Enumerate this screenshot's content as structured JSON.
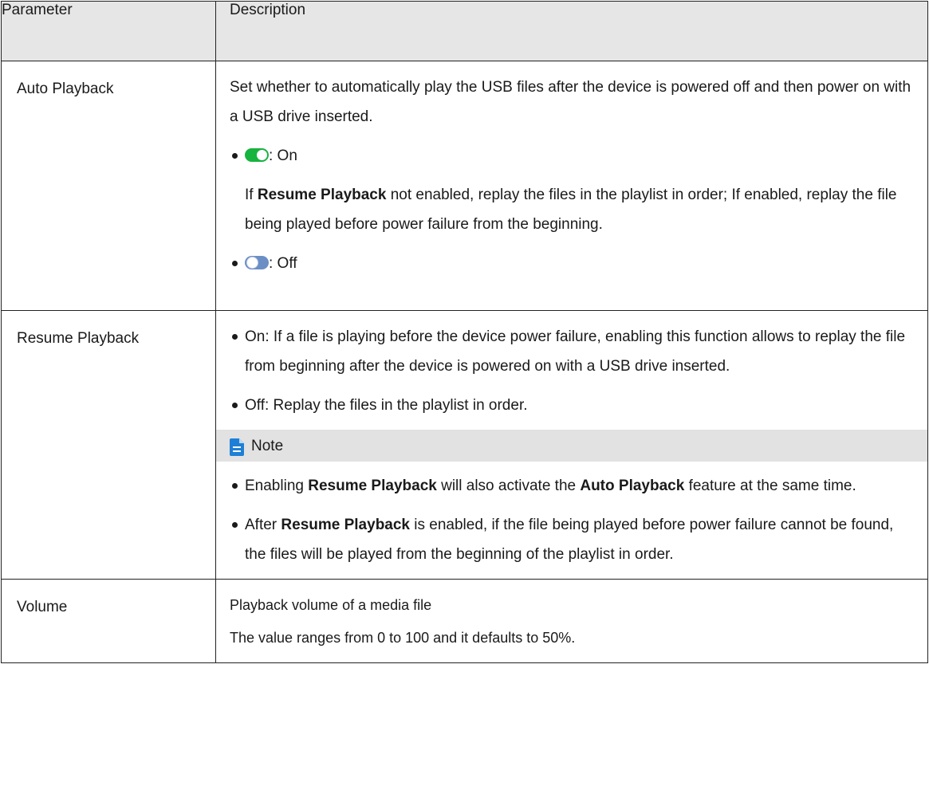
{
  "table": {
    "header": {
      "param": "Parameter",
      "desc": "Description"
    },
    "rows": {
      "auto": {
        "param": "Auto Playback",
        "intro": "Set whether to automatically play the USB files after the device is powered off and then power on with a USB drive inserted.",
        "on_label": ": On",
        "on_detail_bold": "Resume Playback",
        "on_detail_rest": " not enabled, replay the files in the playlist in order; If enabled, replay the file being played before power failure from the beginning.",
        "on_detail_prefix": "If ",
        "off_label": ": Off"
      },
      "resume": {
        "param": "Resume Playback",
        "bullet1": "On: If a file is playing before the device power failure, enabling this function allows to replay the file from beginning after the device is powered on with a USB drive inserted.",
        "bullet2": "Off: Replay the files in the playlist in order.",
        "note_title": "Note",
        "note1_a": "Enabling ",
        "note1_b": "Resume Playback",
        "note1_c": " will also activate the ",
        "note1_d": "Auto Playback",
        "note1_e": " feature at the same time.",
        "note2_a": "After ",
        "note2_b": "Resume Playback",
        "note2_c": " is enabled, if the file being played before power failure cannot be found, the files will be played from the beginning of the playlist in order."
      },
      "volume": {
        "param": "Volume",
        "line1": "Playback volume of a media file",
        "line2": "The value ranges from 0 to 100 and it defaults to 50%."
      }
    }
  },
  "colors": {
    "header_bg": "#e6e6e6",
    "toggle_on": "#17b33f",
    "toggle_off": "#6b8ec4",
    "note_icon": "#1e7fd6",
    "note_bg": "#e2e2e2"
  },
  "icons": {
    "toggle_on": "toggle-on-icon",
    "toggle_off": "toggle-off-icon",
    "note": "note-document-icon"
  }
}
